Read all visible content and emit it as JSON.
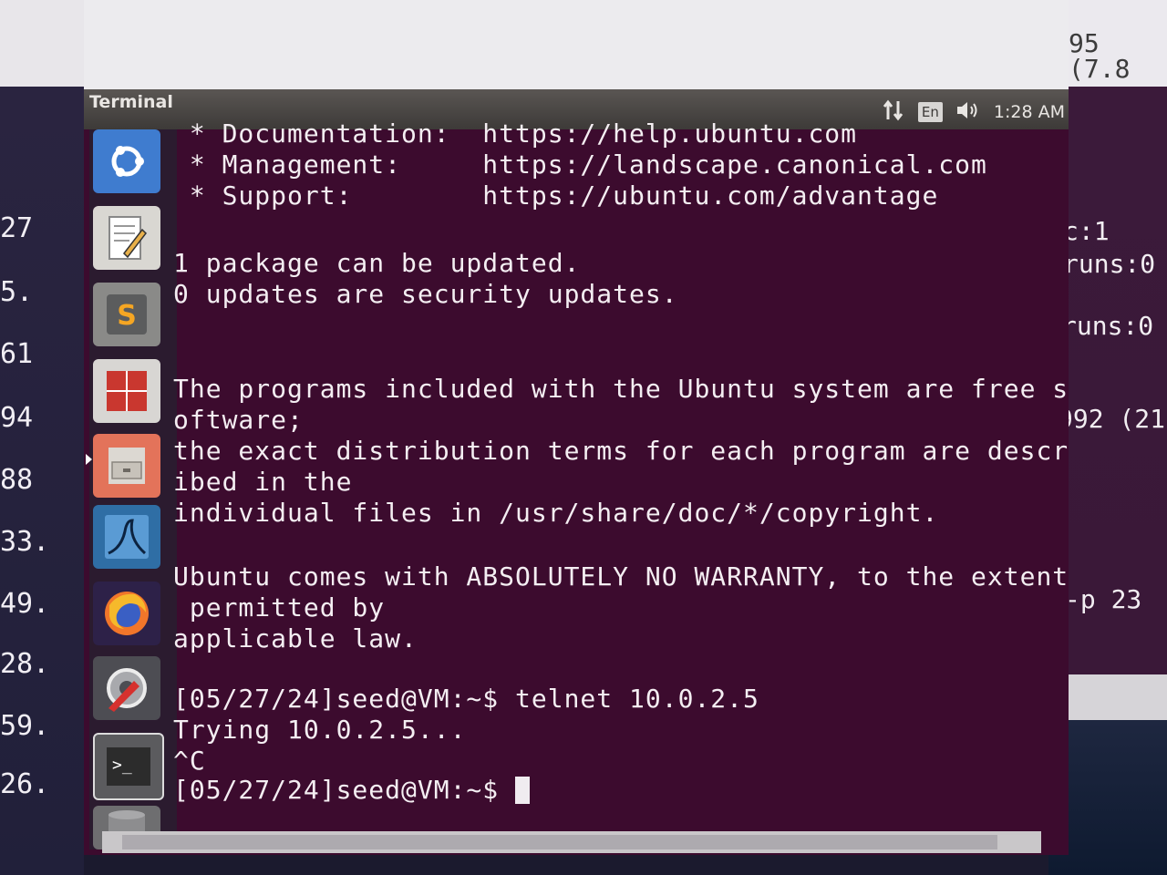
{
  "window": {
    "title": "Terminal"
  },
  "top_panel": {
    "keyboard_layout": "En",
    "network_icon": "network-arrows-icon",
    "volume_icon": "speaker-volume-icon",
    "clock": "1:28 AM"
  },
  "launcher": {
    "items": [
      {
        "name": "ubuntu-dash-icon"
      },
      {
        "name": "text-editor-icon"
      },
      {
        "name": "sublime-text-icon"
      },
      {
        "name": "calculator-grid-icon"
      },
      {
        "name": "file-cabinet-icon"
      },
      {
        "name": "wireshark-icon"
      },
      {
        "name": "firefox-icon"
      },
      {
        "name": "system-settings-icon"
      },
      {
        "name": "terminal-icon"
      },
      {
        "name": "drive-icon"
      }
    ]
  },
  "terminal": {
    "lines": [
      " * Documentation:  https://help.ubuntu.com",
      " * Management:     https://landscape.canonical.com",
      " * Support:        https://ubuntu.com/advantage",
      "",
      "1 package can be updated.",
      "0 updates are security updates.",
      "",
      "",
      "The programs included with the Ubuntu system are free s",
      "oftware;",
      "the exact distribution terms for each program are descr",
      "ibed in the",
      "individual files in /usr/share/doc/*/copyright.",
      "",
      "Ubuntu comes with ABSOLUTELY NO WARRANTY, to the extent",
      " permitted by",
      "applicable law.",
      "",
      "[05/27/24]seed@VM:~$ telnet 10.0.2.5",
      "Trying 10.0.2.5...",
      "^C"
    ],
    "prompt": "[05/27/24]seed@VM:~$ "
  },
  "background_left": [
    "27",
    "5.",
    "61",
    "94",
    "88",
    "33.",
    "49.",
    "28.",
    "59.",
    "26."
  ],
  "background_right": [
    "95 (7.8",
    "c:1",
    "runs:0",
    "runs:0",
    "992 (21",
    "-p 23"
  ]
}
